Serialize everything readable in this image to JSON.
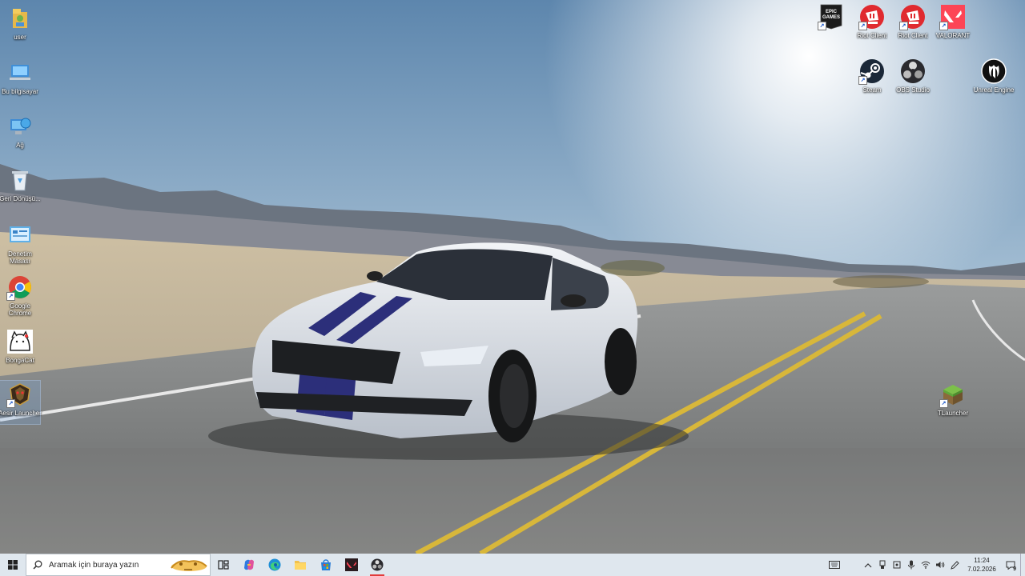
{
  "desktop": {
    "left_icons": [
      {
        "name": "user-folder-icon",
        "label": "user"
      },
      {
        "name": "this-pc-icon",
        "label": "Bu bilgisayar"
      },
      {
        "name": "network-icon",
        "label": "Ağ"
      },
      {
        "name": "recycle-bin-icon",
        "label": "Geri Dönüşü..."
      },
      {
        "name": "control-panel-icon",
        "label": "Denetim Masası"
      },
      {
        "name": "google-chrome-icon",
        "label": "Google Chrome"
      },
      {
        "name": "bongacat-icon",
        "label": "BongaCat"
      },
      {
        "name": "aesir-launcher-icon",
        "label": "Aesir Launcher"
      }
    ],
    "right_icons": [
      {
        "name": "epic-games-icon",
        "label": ""
      },
      {
        "name": "riot-client-icon",
        "label": "Riot Client"
      },
      {
        "name": "riot-client-icon-2",
        "label": "Riot Client"
      },
      {
        "name": "valorant-icon",
        "label": "VALORANT"
      },
      {
        "name": "steam-icon",
        "label": "Steam"
      },
      {
        "name": "obs-studio-icon",
        "label": "OBS Studio"
      },
      {
        "name": "unreal-engine-icon",
        "label": "Unreal Engine"
      },
      {
        "name": "tlauncher-icon",
        "label": "TLauncher"
      }
    ],
    "epic_logo_text": "EPIC GAMES"
  },
  "taskbar": {
    "search_placeholder": "Aramak için buraya yazın",
    "clock_time": "11:24",
    "clock_date": "7.02.2026",
    "notification_count": "9"
  },
  "colors": {
    "taskbar_bg": "#dfe7ee",
    "riot_red": "#e02a2f",
    "valorant_red": "#fd4556",
    "chrome_red": "#db4437",
    "chrome_yellow": "#f4c20d",
    "chrome_green": "#0f9d58",
    "chrome_blue": "#4285f4"
  }
}
